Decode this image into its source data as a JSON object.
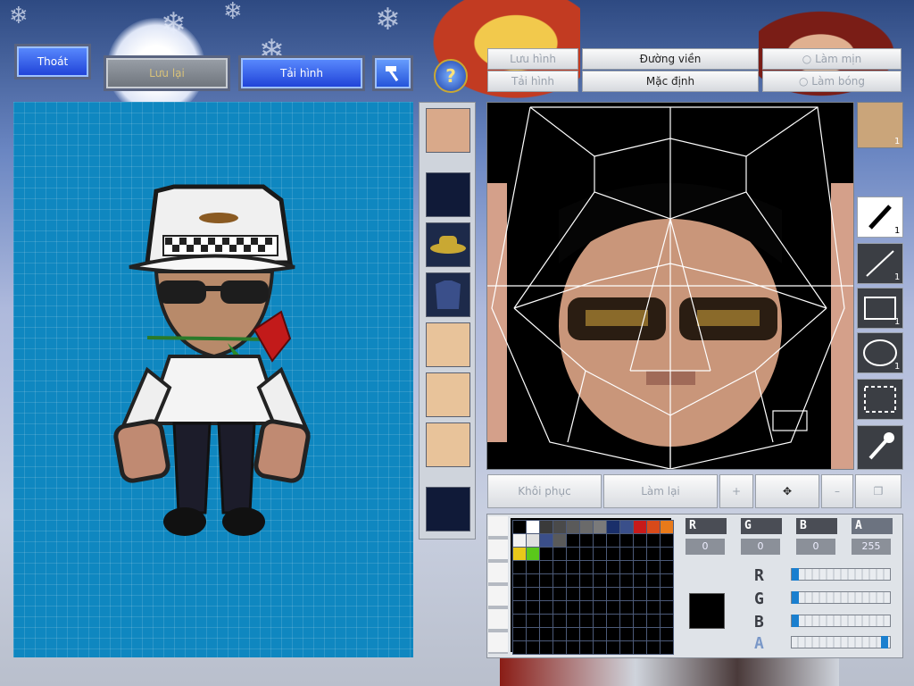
{
  "top_buttons": {
    "exit": "Thoát",
    "save": "Lưu lại",
    "reload": "Tải hình"
  },
  "help_icon": "question-icon",
  "hammer_icon": "hammer-icon",
  "toolbar": {
    "save_image": "Lưu hình",
    "load_image": "Tải hình",
    "outline": "Đường viền",
    "default": "Mặc định",
    "smooth": "Làm mịn",
    "shade": "Làm bóng"
  },
  "bottom_buttons": {
    "restore": "Khôi phục",
    "redo": "Làm lại"
  },
  "tools": [
    {
      "icon": "pen-icon",
      "count": "1"
    },
    {
      "icon": "line-icon",
      "count": "1"
    },
    {
      "icon": "rectangle-icon",
      "count": "1"
    },
    {
      "icon": "ellipse-icon",
      "count": "1"
    },
    {
      "icon": "select-rect-icon",
      "count": ""
    },
    {
      "icon": "eyedropper-icon",
      "count": ""
    }
  ],
  "avatar_count": "1",
  "channels": {
    "r_label": "R",
    "g_label": "G",
    "b_label": "B",
    "a_label": "A",
    "r": "0",
    "g": "0",
    "b": "0",
    "a": "255"
  },
  "slider_labels": {
    "r": "R",
    "g": "G",
    "b": "B",
    "a": "A"
  },
  "slider_values": {
    "r": 0,
    "g": 0,
    "b": 0,
    "a": 255
  },
  "current_color": "#000000",
  "palette_row1": [
    "#000000",
    "#ffffff",
    "#3a3a3a",
    "#4a4a4a",
    "#5a5a5a",
    "#6a6a6a",
    "#7a7a7a",
    "#1a2f6a",
    "#3a4f8a",
    "#c81a1a",
    "#d84a1a",
    "#e87a1a",
    "#e8a01a"
  ],
  "palette_row2": [
    "#f2f2f2",
    "#e0e0e0",
    "#3b4f8a",
    "#5a5a5a"
  ],
  "palette_row3": [
    "#e8c81a",
    "#5ac81a"
  ],
  "colors": {
    "grid_bg": "#0f87c0",
    "accent_blue": "#1d3fd6"
  }
}
